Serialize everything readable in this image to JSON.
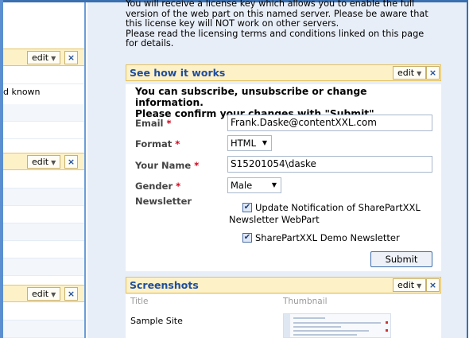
{
  "left_column": {
    "panels": [
      {
        "edit_label": "edit",
        "close_label": "×"
      },
      {
        "edit_label": "edit",
        "close_label": "×"
      },
      {
        "edit_label": "edit",
        "close_label": "×"
      }
    ],
    "visible_text": "d known"
  },
  "intro_text": [
    "You will receive a license key which allows you to enable the full",
    "version of the web part on this named server. Please be aware that",
    "this license key will NOT work on other servers.",
    "Please read the licensing terms and conditions linked on this page",
    "for details."
  ],
  "how_it_works": {
    "title": "See how it works",
    "edit_label": "edit",
    "close_label": "×",
    "intro_line1": "You can subscribe, unsubscribe or change information.",
    "intro_line2": "Please confirm your changes with \"Submit\".",
    "required_marker": "*",
    "fields": {
      "email": {
        "label": "Email",
        "value": "Frank.Daske@contentXXL.com"
      },
      "format": {
        "label": "Format",
        "value": "HTML"
      },
      "your_name": {
        "label": "Your Name",
        "value": "S15201054\\daske"
      },
      "gender": {
        "label": "Gender",
        "value": "Male"
      },
      "newsletter": {
        "label": "Newsletter"
      }
    },
    "newsletters": [
      {
        "line1": "Update Notification of SharePartXXL",
        "line2": "Newsletter WebPart",
        "checked": true
      },
      {
        "line1": "SharePartXXL Demo Newsletter",
        "checked": true
      }
    ],
    "submit_label": "Submit"
  },
  "screenshots": {
    "title": "Screenshots",
    "edit_label": "edit",
    "close_label": "×",
    "col_title": "Title",
    "col_thumbnail": "Thumbnail",
    "rows": [
      {
        "title": "Sample Site"
      }
    ]
  },
  "colors": {
    "header_bg": "#fdf1c8",
    "title_blue": "#1f4e9c",
    "required_red": "#d0021b",
    "frame_blue": "#3a6fb0"
  }
}
